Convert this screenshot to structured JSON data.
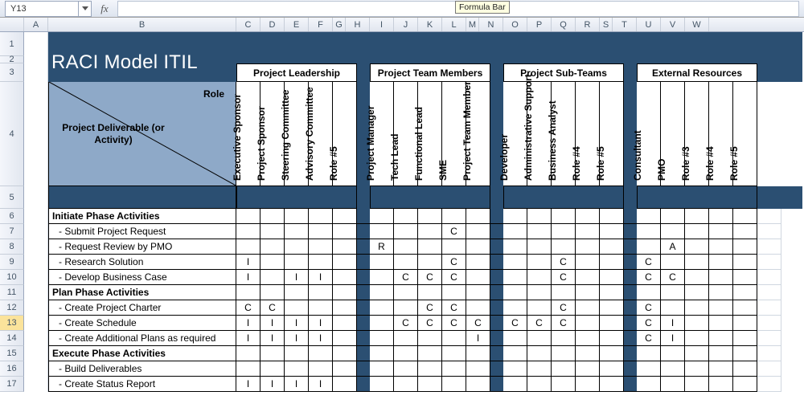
{
  "formula_bar": {
    "name_box": "Y13",
    "fx_label": "fx",
    "tooltip": "Formula Bar"
  },
  "column_letters": [
    "A",
    "B",
    "C",
    "D",
    "E",
    "F",
    "G",
    "H",
    "I",
    "J",
    "K",
    "L",
    "M",
    "N",
    "O",
    "P",
    "Q",
    "R",
    "S",
    "T",
    "U",
    "V",
    "W"
  ],
  "row_numbers": [
    "1",
    "2",
    "3",
    "4",
    "5",
    "6",
    "7",
    "8",
    "9",
    "10",
    "11",
    "12",
    "13",
    "14",
    "15",
    "16",
    "17"
  ],
  "title": "RACI Model ITIL",
  "corner": {
    "role": "Role",
    "deliverable": "Project Deliverable (or Activity)"
  },
  "groups": [
    {
      "label": "Project Leadership",
      "roles": [
        "Executive Sponsor",
        "Project Sponsor",
        "Steering Committee",
        "Advisory Committee",
        "Role #5"
      ]
    },
    {
      "label": "Project Team Members",
      "roles": [
        "Project Manager",
        "Tech Lead",
        "Functional Lead",
        "SME",
        "Project Team Member"
      ]
    },
    {
      "label": "Project Sub-Teams",
      "roles": [
        "Developer",
        "Administrative Support",
        "Business Analyst",
        "Role #4",
        "Role #5"
      ]
    },
    {
      "label": "External Resources",
      "roles": [
        "Consultant",
        "PMO",
        "Role #3",
        "Role #4",
        "Role #5"
      ]
    }
  ],
  "rows": [
    {
      "type": "section",
      "label": "Initiate Phase Activities",
      "cells": [
        [
          "",
          "",
          "",
          "",
          ""
        ],
        [
          "",
          "",
          "",
          "",
          ""
        ],
        [
          "",
          "",
          "",
          "",
          ""
        ],
        [
          "",
          "",
          "",
          "",
          ""
        ]
      ]
    },
    {
      "type": "sub",
      "label": " - Submit Project Request",
      "cells": [
        [
          "",
          "",
          "",
          "",
          ""
        ],
        [
          "",
          "",
          "",
          "C",
          ""
        ],
        [
          "",
          "",
          "",
          "",
          ""
        ],
        [
          "",
          "",
          "",
          "",
          ""
        ]
      ]
    },
    {
      "type": "sub",
      "label": " - Request Review by PMO",
      "cells": [
        [
          "",
          "",
          "",
          "",
          ""
        ],
        [
          "R",
          "",
          "",
          "",
          ""
        ],
        [
          "",
          "",
          "",
          "",
          ""
        ],
        [
          "",
          "A",
          "",
          "",
          ""
        ]
      ]
    },
    {
      "type": "sub",
      "label": " - Research Solution",
      "cells": [
        [
          "I",
          "",
          "",
          "",
          ""
        ],
        [
          "",
          "",
          "",
          "C",
          ""
        ],
        [
          "",
          "",
          "C",
          "",
          ""
        ],
        [
          "C",
          "",
          "",
          "",
          ""
        ]
      ]
    },
    {
      "type": "sub",
      "label": " - Develop Business Case",
      "cells": [
        [
          "I",
          "",
          "I",
          "I",
          ""
        ],
        [
          "",
          "C",
          "C",
          "C",
          ""
        ],
        [
          "",
          "",
          "C",
          "",
          ""
        ],
        [
          "C",
          "C",
          "",
          "",
          ""
        ]
      ]
    },
    {
      "type": "section",
      "label": "Plan Phase Activities",
      "cells": [
        [
          "",
          "",
          "",
          "",
          ""
        ],
        [
          "",
          "",
          "",
          "",
          ""
        ],
        [
          "",
          "",
          "",
          "",
          ""
        ],
        [
          "",
          "",
          "",
          "",
          ""
        ]
      ]
    },
    {
      "type": "sub",
      "label": " - Create Project Charter",
      "cells": [
        [
          "C",
          "C",
          "",
          "",
          ""
        ],
        [
          "",
          "",
          "C",
          "C",
          ""
        ],
        [
          "",
          "",
          "C",
          "",
          ""
        ],
        [
          "C",
          "",
          "",
          "",
          ""
        ]
      ]
    },
    {
      "type": "sub",
      "label": " - Create Schedule",
      "cells": [
        [
          "I",
          "I",
          "I",
          "I",
          ""
        ],
        [
          "",
          "C",
          "C",
          "C",
          "C"
        ],
        [
          "C",
          "C",
          "C",
          "",
          ""
        ],
        [
          "C",
          "I",
          "",
          "",
          ""
        ]
      ]
    },
    {
      "type": "sub",
      "label": " - Create Additional Plans as required",
      "cells": [
        [
          "I",
          "I",
          "I",
          "I",
          ""
        ],
        [
          "",
          "",
          "",
          "",
          "I"
        ],
        [
          "",
          "",
          "",
          "",
          ""
        ],
        [
          "C",
          "I",
          "",
          "",
          ""
        ]
      ]
    },
    {
      "type": "section",
      "label": "Execute Phase Activities",
      "cells": [
        [
          "",
          "",
          "",
          "",
          ""
        ],
        [
          "",
          "",
          "",
          "",
          ""
        ],
        [
          "",
          "",
          "",
          "",
          ""
        ],
        [
          "",
          "",
          "",
          "",
          ""
        ]
      ]
    },
    {
      "type": "sub",
      "label": " - Build Deliverables",
      "cells": [
        [
          "",
          "",
          "",
          "",
          ""
        ],
        [
          "",
          "",
          "",
          "",
          ""
        ],
        [
          "",
          "",
          "",
          "",
          ""
        ],
        [
          "",
          "",
          "",
          "",
          ""
        ]
      ]
    },
    {
      "type": "sub",
      "label": " - Create Status Report",
      "cells": [
        [
          "I",
          "I",
          "I",
          "I",
          ""
        ],
        [
          "",
          "",
          "",
          "",
          ""
        ],
        [
          "",
          "",
          "",
          "",
          ""
        ],
        [
          "",
          "",
          "",
          "",
          ""
        ]
      ]
    }
  ],
  "selected_row": 13
}
